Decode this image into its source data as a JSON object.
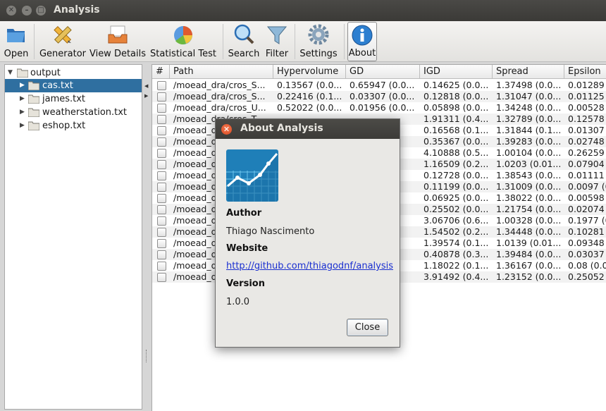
{
  "window": {
    "title": "Analysis"
  },
  "toolbar": {
    "open": "Open",
    "generator": "Generator",
    "view_details": "View Details",
    "statistical_test": "Statistical Test",
    "search": "Search",
    "filter": "Filter",
    "settings": "Settings",
    "about": "About"
  },
  "tree": {
    "root": "output",
    "items": [
      "cas.txt",
      "james.txt",
      "weatherstation.txt",
      "eshop.txt"
    ],
    "selected": "cas.txt"
  },
  "table": {
    "columns": [
      "#",
      "Path",
      "Hypervolume",
      "GD",
      "IGD",
      "Spread",
      "Epsilon"
    ],
    "rows": [
      {
        "path": "/moead_dra/cros_S...",
        "hv": "0.13567 (0.0...",
        "gd": "0.65947 (0.0...",
        "igd": "0.14625 (0.0...",
        "spread": "1.37498 (0.0...",
        "eps": "0.01289 ("
      },
      {
        "path": "/moead_dra/cros_S...",
        "hv": "0.22416 (0.1...",
        "gd": "0.03307 (0.0...",
        "igd": "0.12818 (0.0...",
        "spread": "1.31047 (0.0...",
        "eps": "0.01125 ("
      },
      {
        "path": "/moead_dra/cros_U...",
        "hv": "0.52022 (0.0...",
        "gd": "0.01956 (0.0...",
        "igd": "0.05898 (0.0...",
        "spread": "1.34248 (0.0...",
        "eps": "0.00528 ("
      },
      {
        "path": "/moead_dra/cros_T...",
        "hv": "",
        "gd": "",
        "igd": "1.91311 (0.4...",
        "spread": "1.32789 (0.0...",
        "eps": "0.12578 ("
      },
      {
        "path": "/moead_dra/cros_S...",
        "hv": "",
        "gd": "",
        "igd": "0.16568 (0.1...",
        "spread": "1.31844 (0.1...",
        "eps": "0.01307 ("
      },
      {
        "path": "/moead_d",
        "hv": "",
        "gd": "",
        "igd": "0.35367 (0.0...",
        "spread": "1.39283 (0.0...",
        "eps": "0.02748 ("
      },
      {
        "path": "/moead_d",
        "hv": "",
        "gd": "",
        "igd": "4.10888 (0.5...",
        "spread": "1.00104 (0.0...",
        "eps": "0.26259 ("
      },
      {
        "path": "/moead_d",
        "hv": "",
        "gd": "",
        "igd": "1.16509 (0.2...",
        "spread": "1.0203 (0.01...",
        "eps": "0.07904 ("
      },
      {
        "path": "/moead_d",
        "hv": "",
        "gd": "",
        "igd": "0.12728 (0.0...",
        "spread": "1.38543 (0.0...",
        "eps": "0.01111 ("
      },
      {
        "path": "/moead_d",
        "hv": "",
        "gd": "",
        "igd": "0.11199 (0.0...",
        "spread": "1.31009 (0.0...",
        "eps": "0.0097 (0"
      },
      {
        "path": "/moead_d",
        "hv": "",
        "gd": "",
        "igd": "0.06925 (0.0...",
        "spread": "1.38022 (0.0...",
        "eps": "0.00598 ("
      },
      {
        "path": "/moead_d",
        "hv": "",
        "gd": "",
        "igd": "0.25502 (0.0...",
        "spread": "1.21754 (0.0...",
        "eps": "0.02074 ("
      },
      {
        "path": "/moead_d",
        "hv": "",
        "gd": "",
        "igd": "3.06706 (0.6...",
        "spread": "1.00328 (0.0...",
        "eps": "0.1977 (0"
      },
      {
        "path": "/moead_d",
        "hv": "",
        "gd": "",
        "igd": "1.54502 (0.2...",
        "spread": "1.34448 (0.0...",
        "eps": "0.10281 ("
      },
      {
        "path": "/moead_d",
        "hv": "",
        "gd": "",
        "igd": "1.39574 (0.1...",
        "spread": "1.0139 (0.01...",
        "eps": "0.09348 ("
      },
      {
        "path": "/moead_d",
        "hv": "",
        "gd": "",
        "igd": "0.40878 (0.3...",
        "spread": "1.39484 (0.0...",
        "eps": "0.03037 ("
      },
      {
        "path": "/moead_d",
        "hv": "",
        "gd": "",
        "igd": "1.18022 (0.1...",
        "spread": "1.36167 (0.0...",
        "eps": "0.08 (0.0"
      },
      {
        "path": "/moead_d",
        "hv": "",
        "gd": "",
        "igd": "3.91492 (0.4...",
        "spread": "1.23152 (0.0...",
        "eps": "0.25052 ("
      }
    ]
  },
  "dialog": {
    "title": "About Analysis",
    "author_label": "Author",
    "author": "Thiago Nascimento",
    "website_label": "Website",
    "website": "http://github.com/thiagodnf/analysis",
    "version_label": "Version",
    "version": "1.0.0",
    "close": "Close"
  },
  "colors": {
    "selection": "#2f6fa0",
    "titlebar": "#3c3b38",
    "link": "#1a2fd0",
    "dialog_close": "#e05a2e"
  }
}
